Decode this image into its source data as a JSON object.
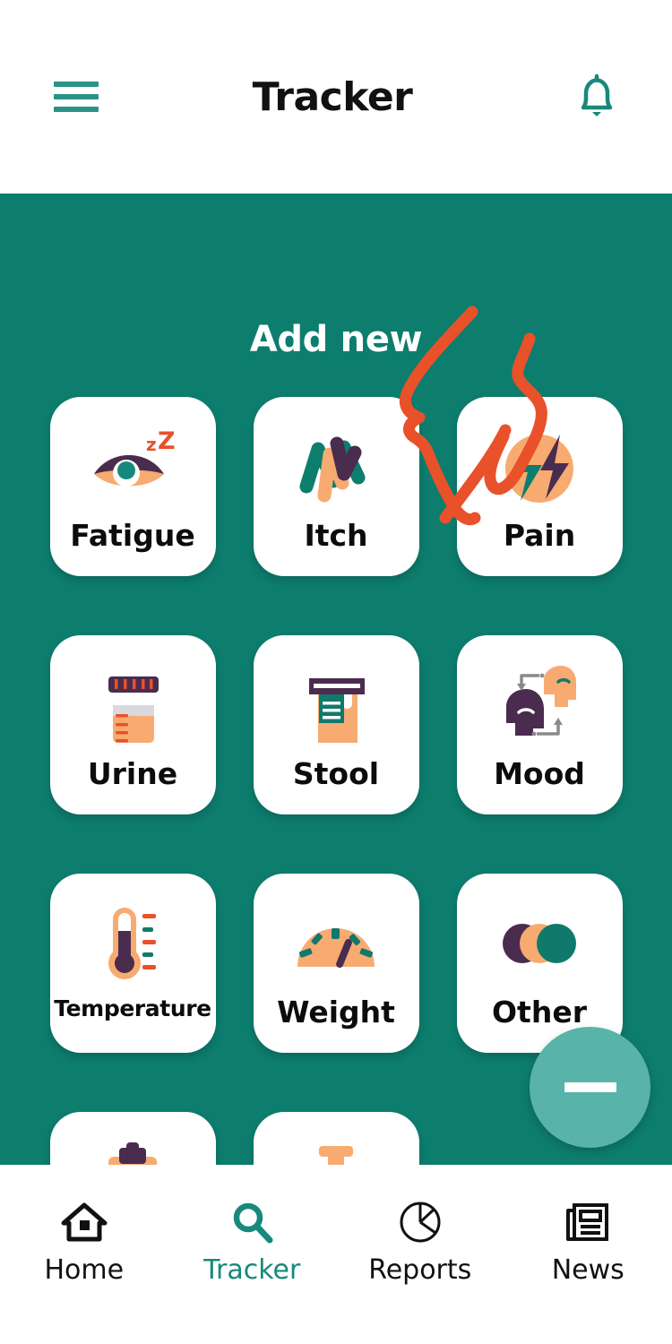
{
  "header": {
    "title": "Tracker",
    "menu_icon": "hamburger-menu-icon",
    "notification_icon": "bell-icon"
  },
  "main": {
    "section_title": "Add new",
    "cards": [
      {
        "label": "Fatigue",
        "icon": "eye-sleep-icon"
      },
      {
        "label": "Itch",
        "icon": "scribble-wave-icon"
      },
      {
        "label": "Pain",
        "icon": "lightning-bolt-icon"
      },
      {
        "label": "Urine",
        "icon": "urine-sample-cup-icon"
      },
      {
        "label": "Stool",
        "icon": "stool-sample-container-icon"
      },
      {
        "label": "Mood",
        "icon": "two-heads-exchange-icon"
      },
      {
        "label": "Temperature",
        "icon": "thermometer-icon"
      },
      {
        "label": "Weight",
        "icon": "gauge-scale-icon"
      },
      {
        "label": "Other",
        "icon": "three-circles-icon"
      },
      {
        "label": "",
        "icon": "clipboard-icon"
      },
      {
        "label": "",
        "icon": "bone-column-icon"
      }
    ]
  },
  "fab": {
    "icon": "minus-icon",
    "label": ""
  },
  "bottom_nav": {
    "items": [
      {
        "label": "Home",
        "icon": "home-icon",
        "active": false
      },
      {
        "label": "Tracker",
        "icon": "search-icon",
        "active": true
      },
      {
        "label": "Reports",
        "icon": "pie-chart-icon",
        "active": false
      },
      {
        "label": "News",
        "icon": "newspaper-icon",
        "active": false
      }
    ]
  },
  "annotation": {
    "type": "freehand-drawing",
    "color": "#e8512a"
  },
  "colors": {
    "brand_teal": "#0d7d6e",
    "accent_teal": "#17897c",
    "fab_teal": "#58b3a8",
    "peach": "#f7ab70",
    "purple": "#4a2c4e",
    "orange": "#e8512a",
    "card_white": "#ffffff"
  }
}
